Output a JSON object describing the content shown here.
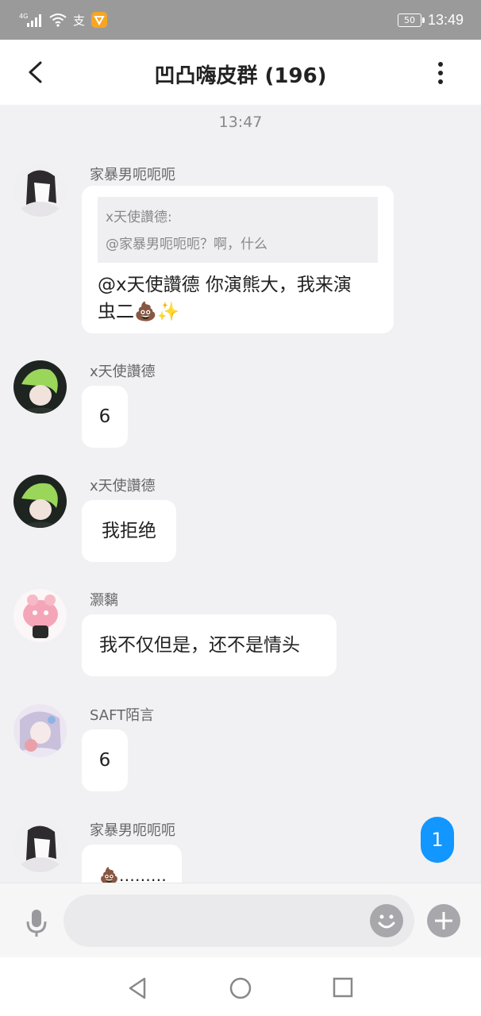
{
  "status_bar": {
    "network": "4G",
    "battery": "50",
    "pay_icon": "支",
    "clock": "13:49"
  },
  "header": {
    "title": "凹凸嗨皮群 (196)"
  },
  "timestamp": "13:47",
  "messages": [
    {
      "sender": "家暴男呃呃呃",
      "quote_name": "x天使讚德:",
      "quote_text": "@家暴男呃呃呃？啊，什么",
      "text_line1": "@x天使讚德 你演熊大，我来演",
      "text_line2": "虫二💩✨"
    },
    {
      "sender": "x天使讚德",
      "text": "6"
    },
    {
      "sender": "x天使讚德",
      "text": "我拒绝"
    },
    {
      "sender": "灏黐",
      "text": "我不仅但是，还不是情头"
    },
    {
      "sender": "SAFT陌言",
      "text": "6"
    },
    {
      "sender": "家暴男呃呃呃",
      "text": "💩………"
    }
  ],
  "unread_count": "1",
  "colors": {
    "accent": "#1296ff",
    "background": "#f1f1f3",
    "status_bar": "#9a9a9a"
  },
  "icons": {
    "back": "chevron-left-icon",
    "more": "more-vertical-icon",
    "mic": "microphone-icon",
    "emoji": "smiley-icon",
    "plus": "plus-icon",
    "nav_back": "triangle-back-icon",
    "nav_home": "circle-home-icon",
    "nav_recent": "square-recent-icon"
  }
}
